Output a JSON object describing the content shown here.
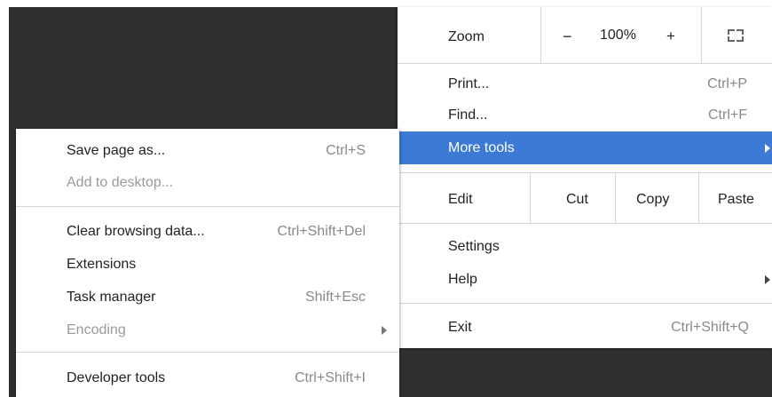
{
  "main_menu": {
    "zoom": {
      "label": "Zoom",
      "minus": "−",
      "value": "100%",
      "plus": "+",
      "fullscreen_icon": "fullscreen-icon"
    },
    "print": {
      "label": "Print...",
      "shortcut": "Ctrl+P"
    },
    "find": {
      "label": "Find...",
      "shortcut": "Ctrl+F"
    },
    "more_tools": {
      "label": "More tools"
    },
    "edit": {
      "label": "Edit",
      "cut": "Cut",
      "copy": "Copy",
      "paste": "Paste"
    },
    "settings": {
      "label": "Settings"
    },
    "help": {
      "label": "Help"
    },
    "exit": {
      "label": "Exit",
      "shortcut": "Ctrl+Shift+Q"
    }
  },
  "sub_menu": {
    "save_page": {
      "label": "Save page as...",
      "shortcut": "Ctrl+S"
    },
    "add_desktop": {
      "label": "Add to desktop..."
    },
    "clear_data": {
      "label": "Clear browsing data...",
      "shortcut": "Ctrl+Shift+Del"
    },
    "extensions": {
      "label": "Extensions"
    },
    "task_manager": {
      "label": "Task manager",
      "shortcut": "Shift+Esc"
    },
    "encoding": {
      "label": "Encoding"
    },
    "dev_tools": {
      "label": "Developer tools",
      "shortcut": "Ctrl+Shift+I"
    }
  },
  "colors": {
    "highlight": "#3c7ad6",
    "background": "#2f2f2f"
  }
}
